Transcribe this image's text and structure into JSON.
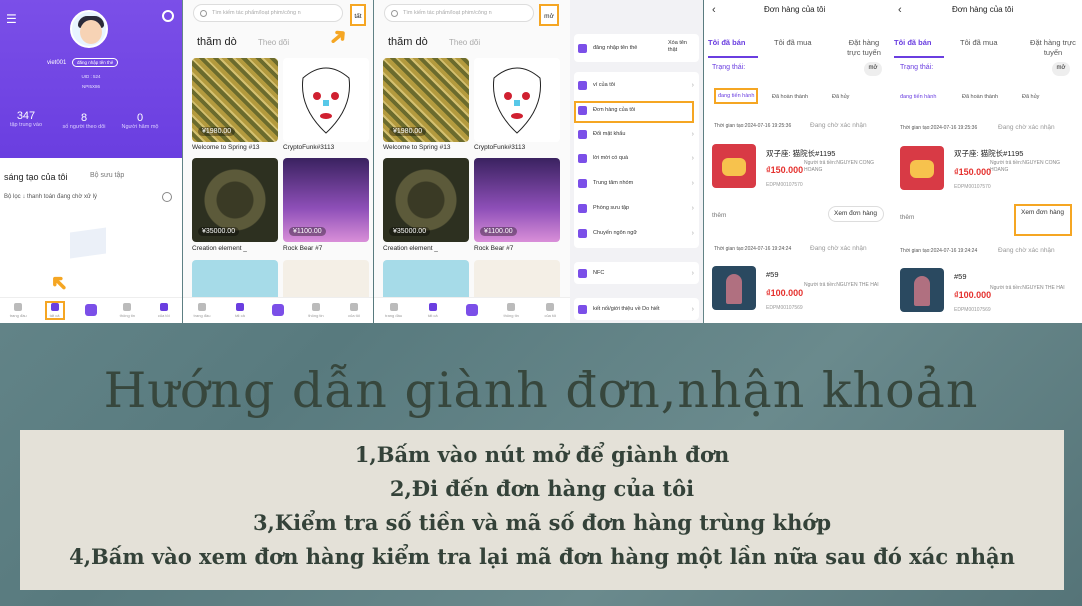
{
  "profile": {
    "username": "viet001",
    "login_badge": "đăng nhập tên thẻ",
    "uid": "UID : 524",
    "code": "NPI5X86",
    "stats": [
      {
        "num": "347",
        "label": "tập trung vào"
      },
      {
        "num": "8",
        "label": "số người theo dõi"
      },
      {
        "num": "0",
        "label": "Người hâm mộ"
      }
    ],
    "tab_active": "sáng tạo của tôi",
    "tab_other": "Bộ sưu tập",
    "filter": "Bộ lọc ↓ thanh toán đang chờ xử lý"
  },
  "tabbar": [
    {
      "label": "trang đầu"
    },
    {
      "label": "tất cả"
    },
    {
      "label": ""
    },
    {
      "label": "thông tin"
    },
    {
      "label": "của tôi"
    }
  ],
  "explore1": {
    "search_placeholder": "Tìm kiếm tác phẩm/loạt phim/công n",
    "search_btn": "tất",
    "tab_active": "thăm dò",
    "tab_other": "Theo dõi",
    "cards": [
      {
        "name": "Welcome to Spring #13",
        "price": "¥1980.00"
      },
      {
        "name": "CryptoFunk#3113",
        "price": ""
      },
      {
        "name": "Creation element _",
        "price": "¥35000.00"
      },
      {
        "name": "Rock Bear #7",
        "price": "¥1100.00"
      }
    ]
  },
  "explore2": {
    "search_placeholder": "Tìm kiếm tác phẩm/loạt phim/công n",
    "search_btn": "mở",
    "tab_active": "thăm dò",
    "tab_other": "Theo dõi",
    "cards": [
      {
        "name": "Welcome to Spring #13",
        "price": "¥1980.00"
      },
      {
        "name": "CryptoFunk#3113",
        "price": ""
      },
      {
        "name": "Creation element _",
        "price": "¥35000.00"
      },
      {
        "name": "Rock Bear #7",
        "price": "¥1100.00"
      }
    ]
  },
  "menu": {
    "login": "đăng nhập tên thẻ",
    "clear": "Xóa tên thật",
    "group1": [
      "ví của tôi",
      "Đơn hàng của tôi",
      "Đổi mật khẩu",
      "lời mời có quà",
      "Trung tâm nhóm",
      "Phòng sưu tập",
      "Chuyển ngôn ngữ"
    ],
    "nfc": "NFC",
    "intro": "kết nối/giới thiệu về Do hiết"
  },
  "orders": {
    "title": "Đơn hàng của tôi",
    "tabs": [
      "Tôi đã bán",
      "Tôi đã mua",
      "Đặt hàng trực tuyến"
    ],
    "status_label": "Trạng thái:",
    "status_value": "mở",
    "filters": [
      "đang tiến hành",
      "Đã hoàn thành",
      "Đã hủy"
    ],
    "items": [
      {
        "time": "Thời gian tạo:2024-07-16 19:25:36",
        "status": "Đang chờ xác nhận",
        "name": "双子座: 猫院长#1195",
        "price": "₫150.000",
        "payer": "Người trả tiền:NGUYEN CONG HOANG",
        "code": "EDPM00107570"
      },
      {
        "time": "Thời gian tạo:2024-07-16 19:24:24",
        "status": "Đang chờ xác nhận",
        "name": "#59",
        "price": "₫100.000",
        "payer": "Người trả tiền:NGUYEN THE HAI",
        "code": "EDPM00107569"
      }
    ],
    "more": "thêm",
    "view": "Xem đơn hàng"
  },
  "guide": {
    "headline": "Hướng dẫn giành đơn,nhận khoản",
    "steps": [
      "1,Bấm vào nút mở để giành đơn",
      "2,Đi đến đơn hàng của tôi",
      "3,Kiểm tra số tiền và mã số đơn hàng trùng khớp",
      "4,Bấm vào xem đơn hàng kiểm tra lại mã đơn hàng một lần nữa sau đó xác nhận"
    ]
  },
  "colors": {
    "accent": "#6a3ee0",
    "highlight": "#f5a623",
    "price": "#e5312e"
  }
}
